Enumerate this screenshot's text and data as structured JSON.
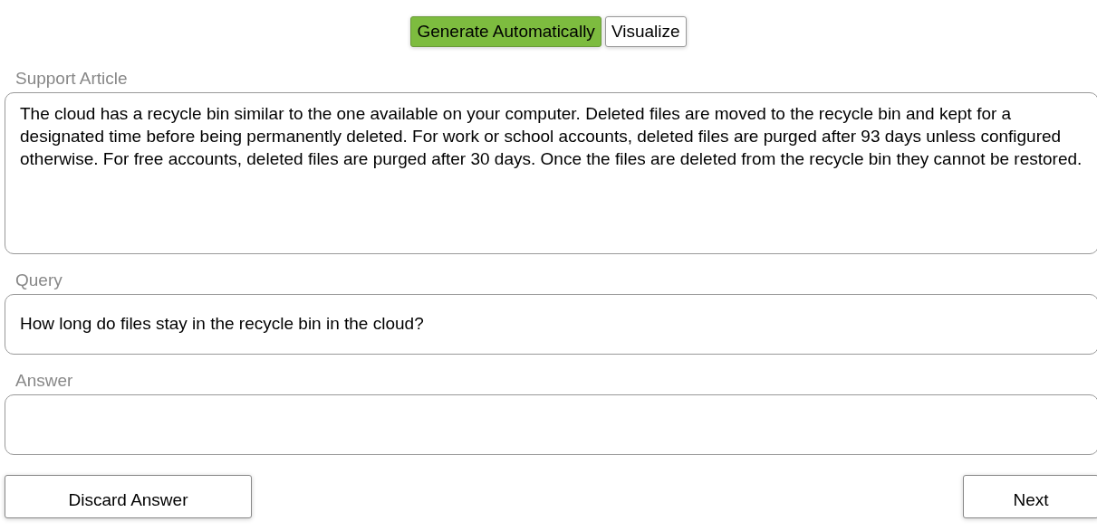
{
  "toolbar": [
    {
      "label": "Generate Automatically",
      "selected": true
    },
    {
      "label": "Visualize",
      "selected": false
    }
  ],
  "fields": [
    {
      "label": "Support Article",
      "value": "The cloud has a recycle bin similar to the one available on your computer. Deleted files are moved to the recycle bin and kept for a designated time before being permanently deleted. For work or school accounts, deleted files are purged after 93 days unless configured otherwise. For free accounts, deleted files are purged after 30 days. Once the files are deleted from the recycle bin they cannot be restored.",
      "kind": "tall"
    },
    {
      "label": "Query",
      "value": "How long do files stay in the recycle bin in the cloud?",
      "kind": "short"
    },
    {
      "label": "Answer",
      "kind": "short"
    }
  ],
  "actions": [
    "Discard Answer",
    "Next"
  ]
}
